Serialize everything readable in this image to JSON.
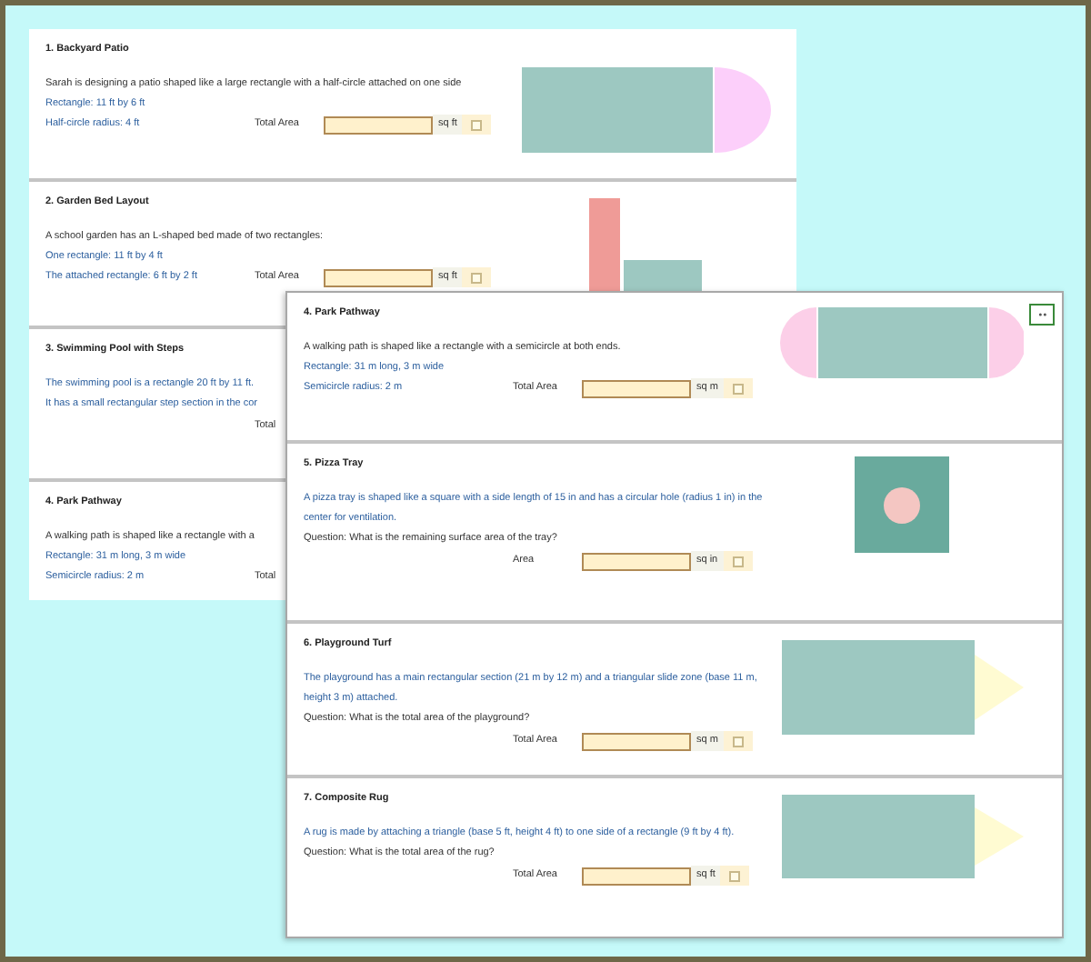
{
  "back_page": {
    "problems": [
      {
        "title": "1. Backyard Patio",
        "lines": [
          {
            "text": "Sarah is designing a patio shaped like a large rectangle with a half-circle attached on one side",
            "kind": "description"
          },
          {
            "text": "Rectangle: 11 ft by 6 ft",
            "kind": "given"
          },
          {
            "text": "Half-circle radius: 4 ft",
            "kind": "given"
          }
        ],
        "answer": {
          "label": "Total Area",
          "unit": "sq ft",
          "checked": false
        },
        "figure": {
          "kind": "patio"
        }
      },
      {
        "title": "2. Garden Bed Layout",
        "lines": [
          {
            "text": "A school garden has an L-shaped bed made of two rectangles:",
            "kind": "description"
          },
          {
            "text": "One rectangle: 11 ft by 4 ft",
            "kind": "given"
          },
          {
            "text": "The attached rectangle: 6 ft by 2 ft",
            "kind": "given"
          }
        ],
        "answer": {
          "label": "Total Area",
          "unit": "sq ft",
          "checked": false
        },
        "figure": {
          "kind": "l_shape"
        }
      },
      {
        "title": "3. Swimming Pool with Steps",
        "lines": [
          {
            "text": "The swimming pool is a rectangle 20 ft by 11 ft.",
            "kind": "prompt"
          },
          {
            "text": "It has a small rectangular step section in the cor",
            "kind": "prompt"
          }
        ],
        "answer": {
          "label": "Total"
        }
      },
      {
        "title": "4. Park Pathway",
        "lines": [
          {
            "text": "A walking path is shaped like a rectangle with a",
            "kind": "description"
          },
          {
            "text": "Rectangle: 31 m long, 3 m wide",
            "kind": "given"
          },
          {
            "text": "Semicircle radius: 2 m",
            "kind": "given"
          }
        ],
        "answer": {
          "label": "Total"
        }
      }
    ]
  },
  "front_page": {
    "problems": [
      {
        "title": "4. Park Pathway",
        "lines": [
          {
            "text": "A walking path is shaped like a rectangle with a semicircle at both ends.",
            "kind": "description"
          },
          {
            "text": "Rectangle: 31 m long, 3 m wide",
            "kind": "given"
          },
          {
            "text": "Semicircle radius: 2 m",
            "kind": "given"
          }
        ],
        "answer": {
          "label": "Total Area",
          "unit": "sq m",
          "checked": false
        },
        "figure": {
          "kind": "pathway"
        }
      },
      {
        "title": "5. Pizza Tray",
        "lines": [
          {
            "text": "A pizza tray is shaped like a square with a side length of 15 in and has a circular hole (radius 1 in) in the center for ventilation.",
            "kind": "prompt"
          },
          {
            "text": "Question: What is the remaining surface area of the tray?",
            "kind": "question"
          }
        ],
        "answer": {
          "label": "Area",
          "unit": "sq in",
          "checked": false
        },
        "figure": {
          "kind": "pizza"
        }
      },
      {
        "title": "6. Playground Turf",
        "lines": [
          {
            "text": "The playground has a main rectangular section (21 m by 12 m) and a triangular slide zone (base 11 m, height 3 m) attached.",
            "kind": "prompt"
          },
          {
            "text": "Question: What is the total area of the playground?",
            "kind": "question"
          }
        ],
        "answer": {
          "label": "Total Area",
          "unit": "sq m",
          "checked": false
        },
        "figure": {
          "kind": "rect_triangle"
        }
      },
      {
        "title": "7. Composite Rug",
        "lines": [
          {
            "text": "A rug is made by attaching a triangle (base 5 ft, height 4 ft) to one side of a rectangle (9 ft by 4 ft).",
            "kind": "prompt"
          },
          {
            "text": "Question: What is the total area of the rug?",
            "kind": "question"
          }
        ],
        "answer": {
          "label": "Total Area",
          "unit": "sq ft",
          "checked": false
        },
        "figure": {
          "kind": "rect_triangle_short"
        }
      }
    ]
  }
}
